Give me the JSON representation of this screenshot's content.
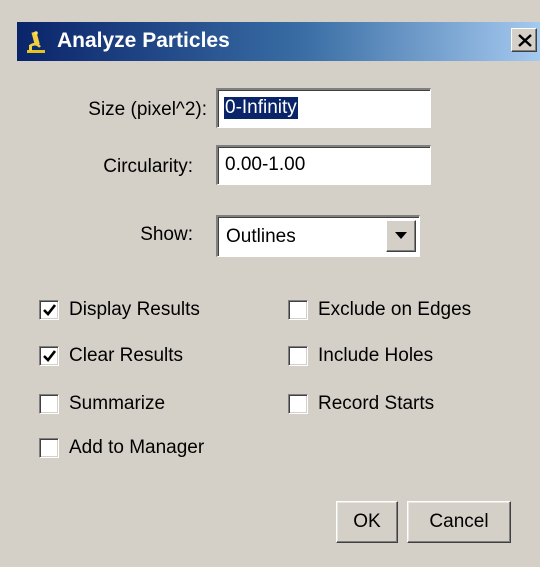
{
  "window": {
    "title": "Analyze Particles",
    "close_label": "✕"
  },
  "fields": {
    "size_label": "Size (pixel^2):",
    "size_value": "0-Infinity",
    "circularity_label": "Circularity:",
    "circularity_value": "0.00-1.00",
    "show_label": "Show:",
    "show_value": "Outlines"
  },
  "options": {
    "display_results": {
      "label": "Display Results",
      "checked": true
    },
    "clear_results": {
      "label": "Clear Results",
      "checked": true
    },
    "summarize": {
      "label": "Summarize",
      "checked": false
    },
    "add_to_manager": {
      "label": "Add to Manager",
      "checked": false
    },
    "exclude_on_edges": {
      "label": "Exclude on Edges",
      "checked": false
    },
    "include_holes": {
      "label": "Include Holes",
      "checked": false
    },
    "record_starts": {
      "label": "Record Starts",
      "checked": false
    }
  },
  "buttons": {
    "ok": "OK",
    "cancel": "Cancel"
  },
  "colors": {
    "title_gradient_start": "#0a246a",
    "title_gradient_end": "#a6caf0",
    "dialog_background": "#d4d0c8",
    "selection": "#0a246a"
  },
  "icons": {
    "app": "microscope-icon",
    "close": "close-icon",
    "dropdown": "chevron-down-icon",
    "check": "checkmark-icon"
  }
}
